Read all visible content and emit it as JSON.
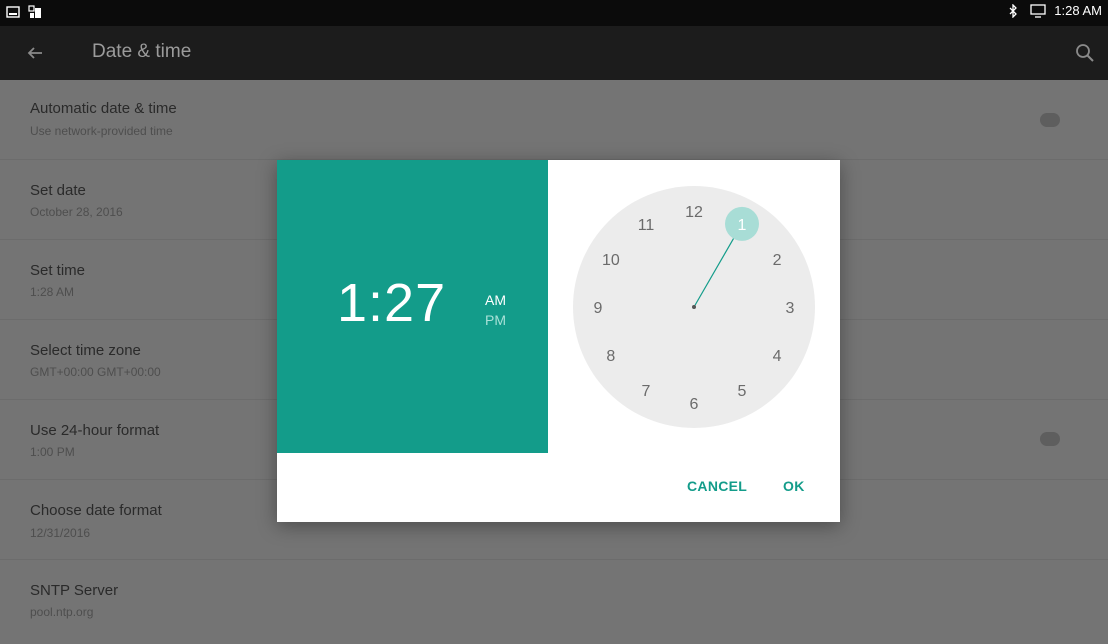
{
  "status_bar": {
    "left_icons": [
      "screenshot-icon",
      "notification-icon"
    ],
    "right_icons": [
      "bluetooth-icon",
      "cast-icon"
    ],
    "time": "1:28 AM"
  },
  "toolbar": {
    "back_icon": "back-arrow-icon",
    "title": "Date & time",
    "search_icon": "search-icon"
  },
  "settings": [
    {
      "title": "Automatic date & time",
      "subtitle": "Use network-provided time",
      "toggle": true
    },
    {
      "title": "Set date",
      "subtitle": "October 28, 2016"
    },
    {
      "title": "Set time",
      "subtitle": "1:28 AM"
    },
    {
      "title": "Select time zone",
      "subtitle": "GMT+00:00 GMT+00:00"
    },
    {
      "title": "Use 24-hour format",
      "subtitle": "1:00 PM",
      "toggle": true
    },
    {
      "title": "Choose date format",
      "subtitle": "12/31/2016"
    },
    {
      "title": "SNTP Server",
      "subtitle": "pool.ntp.org"
    }
  ],
  "dialog": {
    "time": "1:27",
    "am": "AM",
    "pm": "PM",
    "clock_numbers": [
      "12",
      "1",
      "2",
      "3",
      "4",
      "5",
      "6",
      "7",
      "8",
      "9",
      "10",
      "11"
    ],
    "selected_hour": "1",
    "cancel": "CANCEL",
    "ok": "OK"
  },
  "colors": {
    "accent": "#139c8a",
    "status_bar": "#0b0b0b",
    "toolbar": "#1c1c1c"
  }
}
